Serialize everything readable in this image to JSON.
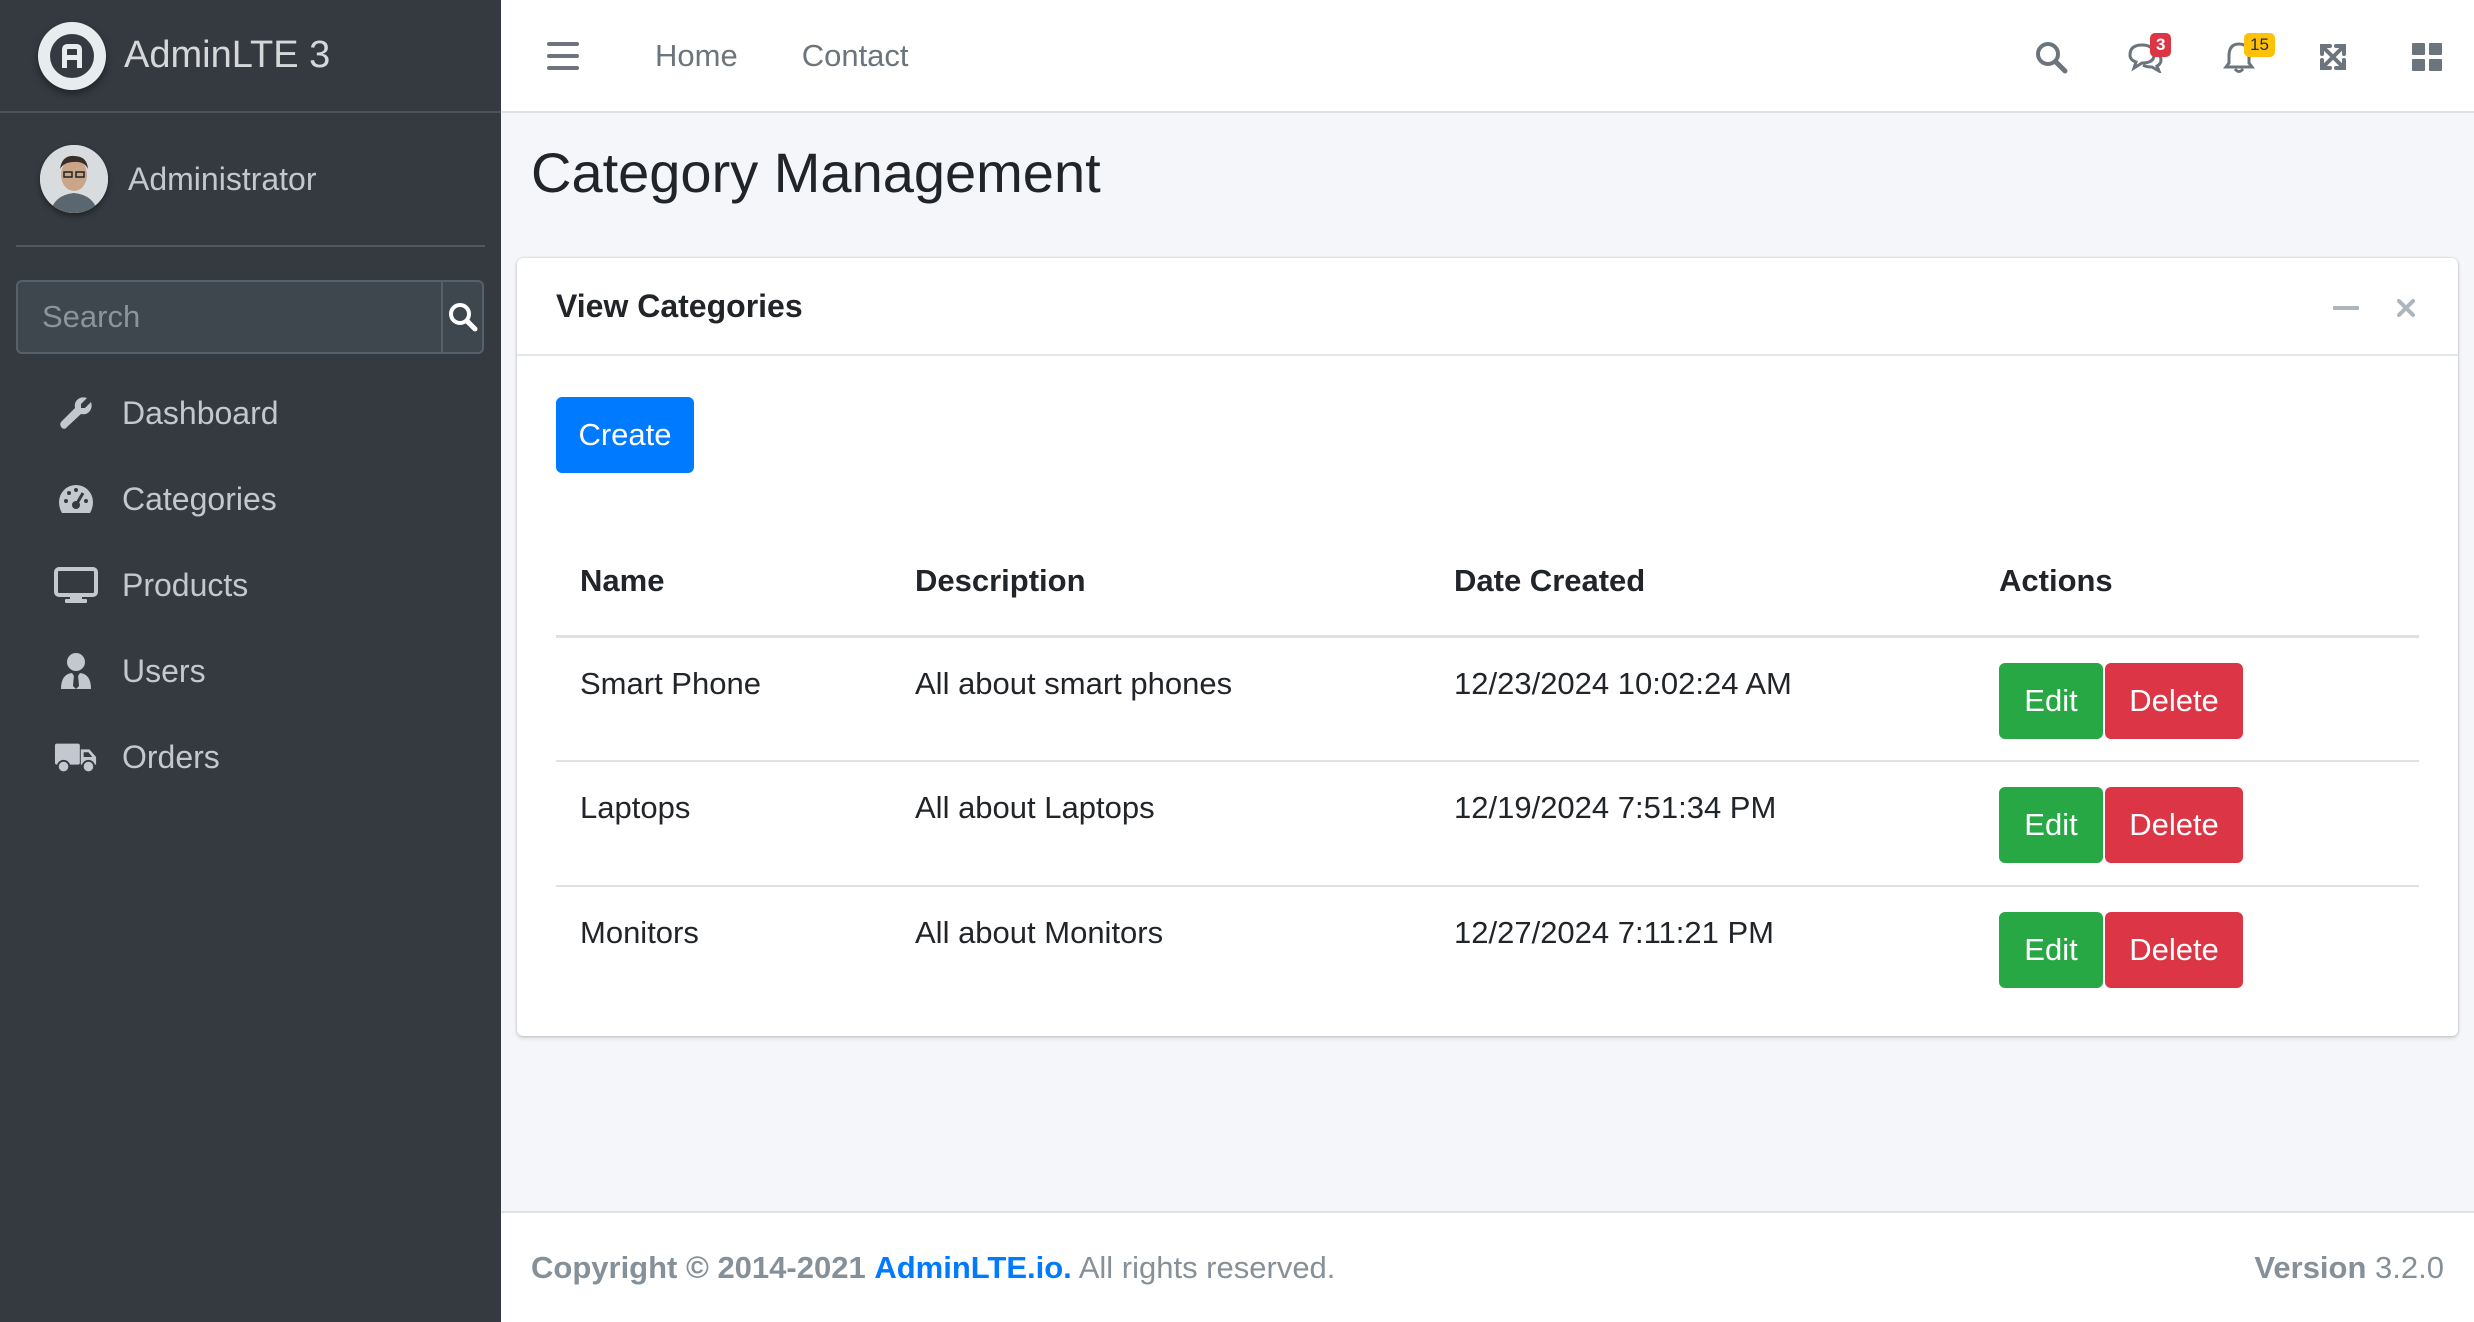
{
  "brand": {
    "name": "AdminLTE 3"
  },
  "user": {
    "name": "Administrator"
  },
  "search": {
    "placeholder": "Search"
  },
  "sidebar": {
    "items": [
      {
        "label": "Dashboard",
        "icon": "wrench-icon"
      },
      {
        "label": "Categories",
        "icon": "tachometer-icon"
      },
      {
        "label": "Products",
        "icon": "desktop-icon"
      },
      {
        "label": "Users",
        "icon": "user-tie-icon"
      },
      {
        "label": "Orders",
        "icon": "truck-icon"
      }
    ]
  },
  "topbar": {
    "links": [
      "Home",
      "Contact"
    ],
    "messages_badge": "3",
    "notifications_badge": "15"
  },
  "page": {
    "title": "Category Management"
  },
  "card": {
    "title": "View Categories",
    "create_label": "Create",
    "columns": [
      "Name",
      "Description",
      "Date Created",
      "Actions"
    ],
    "rows": [
      {
        "name": "Smart Phone",
        "description": "All about smart phones",
        "date": "12/23/2024 10:02:24 AM"
      },
      {
        "name": "Laptops",
        "description": "All about Laptops",
        "date": "12/19/2024 7:51:34 PM"
      },
      {
        "name": "Monitors",
        "description": "All about Monitors",
        "date": "12/27/2024 7:11:21 PM"
      }
    ],
    "edit_label": "Edit",
    "delete_label": "Delete"
  },
  "footer": {
    "copyright": "Copyright © 2014-2021",
    "link": "AdminLTE.io.",
    "rights": "All rights reserved.",
    "version_label": "Version",
    "version": "3.2.0"
  },
  "colors": {
    "sidebar_bg": "#343a40",
    "primary": "#007bff",
    "success": "#28a745",
    "danger": "#dc3545",
    "warning": "#ffc107"
  }
}
